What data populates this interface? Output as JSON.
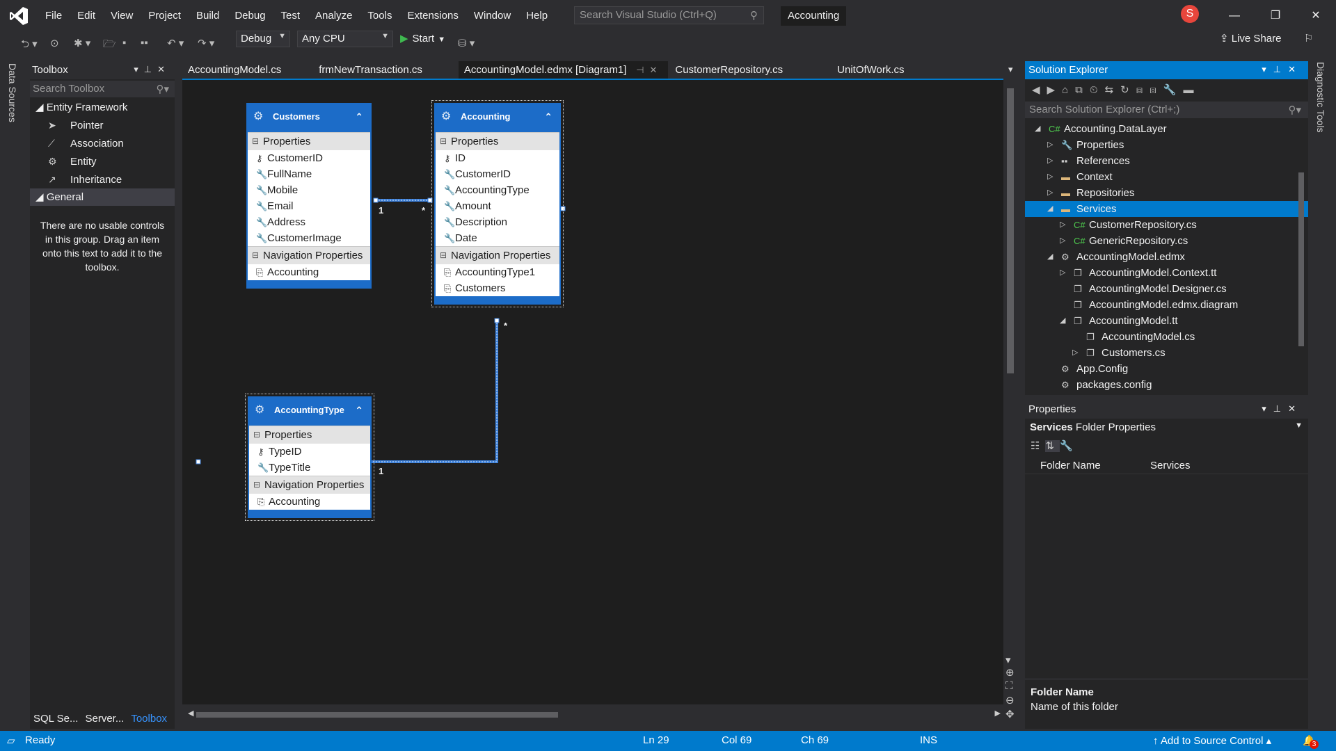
{
  "menu": {
    "items": [
      "File",
      "Edit",
      "View",
      "Project",
      "Build",
      "Debug",
      "Test",
      "Analyze",
      "Tools",
      "Extensions",
      "Window",
      "Help"
    ],
    "search_placeholder": "Search Visual Studio (Ctrl+Q)",
    "solution_name": "Accounting",
    "user_initial": "S"
  },
  "toolbar": {
    "config": "Debug",
    "platform": "Any CPU",
    "start_label": "Start",
    "live_share": "Live Share"
  },
  "left_strip": {
    "label": "Data Sources"
  },
  "right_strip": {
    "label": "Diagnostic Tools"
  },
  "toolbox": {
    "title": "Toolbox",
    "search_placeholder": "Search Toolbox",
    "group1": "Entity Framework",
    "items": [
      {
        "label": "Pointer",
        "icon": "pointer-icon"
      },
      {
        "label": "Association",
        "icon": "association-icon"
      },
      {
        "label": "Entity",
        "icon": "entity-icon"
      },
      {
        "label": "Inheritance",
        "icon": "inheritance-icon"
      }
    ],
    "group2": "General",
    "empty_text": "There are no usable controls in this group. Drag an item onto this text to add it to the toolbox.",
    "bottom_tabs": [
      "SQL Se...",
      "Server...",
      "Toolbox"
    ]
  },
  "tabs": [
    {
      "label": "AccountingModel.cs"
    },
    {
      "label": "frmNewTransaction.cs"
    },
    {
      "label": "AccountingModel.edmx [Diagram1]"
    },
    {
      "label": "CustomerRepository.cs"
    },
    {
      "label": "UnitOfWork.cs"
    }
  ],
  "diagram": {
    "customers": {
      "title": "Customers",
      "props_header": "Properties",
      "props": [
        "CustomerID",
        "FullName",
        "Mobile",
        "Email",
        "Address",
        "CustomerImage"
      ],
      "nav_header": "Navigation Properties",
      "nav": [
        "Accounting"
      ]
    },
    "accounting": {
      "title": "Accounting",
      "props_header": "Properties",
      "props": [
        "ID",
        "CustomerID",
        "AccountingType",
        "Amount",
        "Description",
        "Date"
      ],
      "nav_header": "Navigation Properties",
      "nav": [
        "AccountingType1",
        "Customers"
      ]
    },
    "accounting_type": {
      "title": "AccountingType",
      "props_header": "Properties",
      "props": [
        "TypeID",
        "TypeTitle"
      ],
      "nav_header": "Navigation Properties",
      "nav": [
        "Accounting"
      ]
    },
    "mult_one": "1",
    "mult_many": "*"
  },
  "solution_explorer": {
    "title": "Solution Explorer",
    "search_placeholder": "Search Solution Explorer (Ctrl+;)",
    "nodes": [
      {
        "label": "Accounting.DataLayer",
        "level": 0,
        "exp": "◢",
        "icon": "csharp-project-icon"
      },
      {
        "label": "Properties",
        "level": 1,
        "exp": "▷",
        "icon": "wrench-icon"
      },
      {
        "label": "References",
        "level": 1,
        "exp": "▷",
        "icon": "references-icon"
      },
      {
        "label": "Context",
        "level": 1,
        "exp": "▷",
        "icon": "folder-icon"
      },
      {
        "label": "Repositories",
        "level": 1,
        "exp": "▷",
        "icon": "folder-icon"
      },
      {
        "label": "Services",
        "level": 1,
        "exp": "◢",
        "icon": "folder-open-icon",
        "selected": true
      },
      {
        "label": "CustomerRepository.cs",
        "level": 2,
        "exp": "▷",
        "icon": "csharp-file-icon"
      },
      {
        "label": "GenericRepository.cs",
        "level": 2,
        "exp": "▷",
        "icon": "csharp-file-icon"
      },
      {
        "label": "AccountingModel.edmx",
        "level": 1,
        "exp": "◢",
        "icon": "edmx-icon"
      },
      {
        "label": "AccountingModel.Context.tt",
        "level": 2,
        "exp": "▷",
        "icon": "tt-file-icon"
      },
      {
        "label": "AccountingModel.Designer.cs",
        "level": 2,
        "exp": "",
        "icon": "tt-file-icon"
      },
      {
        "label": "AccountingModel.edmx.diagram",
        "level": 2,
        "exp": "",
        "icon": "tt-file-icon"
      },
      {
        "label": "AccountingModel.tt",
        "level": 2,
        "exp": "◢",
        "icon": "tt-file-icon"
      },
      {
        "label": "AccountingModel.cs",
        "level": 3,
        "exp": "",
        "icon": "tt-file-icon"
      },
      {
        "label": "Customers.cs",
        "level": 3,
        "exp": "▷",
        "icon": "tt-file-icon"
      },
      {
        "label": "App.Config",
        "level": 1,
        "exp": "",
        "icon": "config-icon"
      },
      {
        "label": "packages.config",
        "level": 1,
        "exp": "",
        "icon": "config-icon"
      }
    ]
  },
  "properties": {
    "title": "Properties",
    "object_name": "Services",
    "object_type": "Folder Properties",
    "row_key": "Folder Name",
    "row_value": "Services",
    "desc_title": "Folder Name",
    "desc_text": "Name of this folder"
  },
  "status": {
    "ready": "Ready",
    "ln": "Ln 29",
    "col": "Col 69",
    "ch": "Ch 69",
    "ins": "INS",
    "source_control": "Add to Source Control",
    "notifications": "3"
  }
}
